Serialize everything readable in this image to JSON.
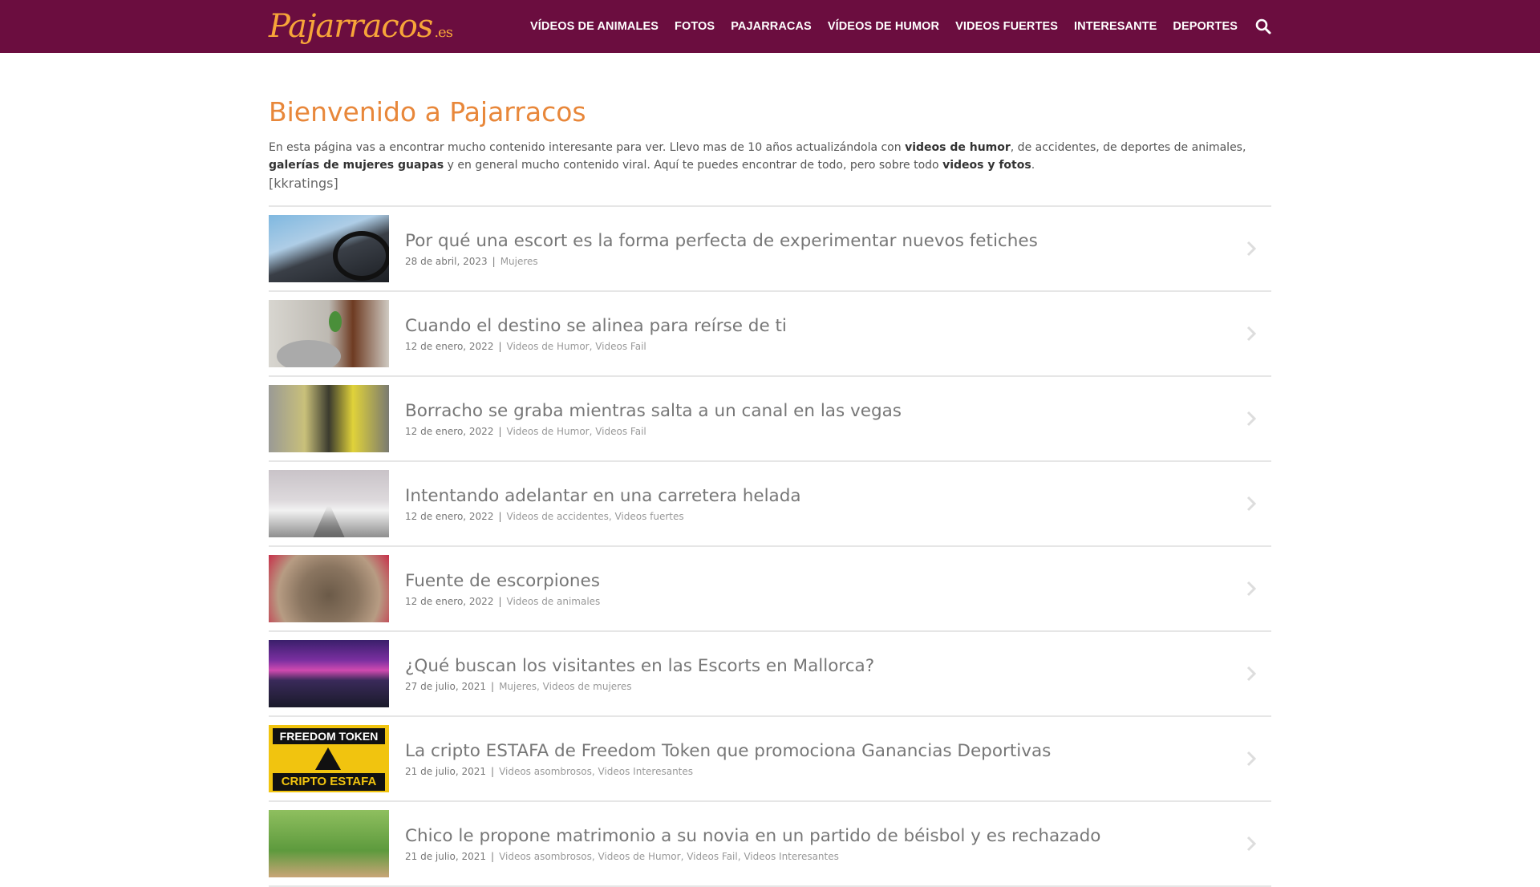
{
  "header": {
    "logo_text": "Pajarracos",
    "logo_suffix": ".es",
    "nav": [
      "VÍDEOS DE ANIMALES",
      "FOTOS",
      "PAJARRACAS",
      "VÍDEOS DE HUMOR",
      "VIDEOS FUERTES",
      "INTERESANTE",
      "DEPORTES"
    ],
    "search_icon": "search-icon"
  },
  "main": {
    "title": "Bienvenido a Pajarracos",
    "intro": {
      "t1": "En esta página vas a encontrar mucho contenido interesante para ver. Llevo mas de 10 años actualizándola con ",
      "b1": "videos de humor",
      "t2": ", de accidentes, de deportes de animales, ",
      "b2": "galerías de mujeres guapas",
      "t3": " y en general mucho contenido viral. Aquí te puedes encontrar de todo, pero sobre todo ",
      "b3": "videos y fotos",
      "t4": "."
    },
    "ratings": "[kkratings]"
  },
  "posts": [
    {
      "title": "Por qué una escort es la forma perfecta de experimentar nuevos fetiches",
      "date": "28 de abril, 2023",
      "cats": "Mujeres"
    },
    {
      "title": "Cuando el destino se alinea para reírse de ti",
      "date": "12 de enero, 2022",
      "cats": "Videos de Humor,  Videos Fail"
    },
    {
      "title": "Borracho se graba mientras salta a un canal en las vegas",
      "date": "12 de enero, 2022",
      "cats": "Videos de Humor,  Videos Fail"
    },
    {
      "title": "Intentando adelantar en una carretera helada",
      "date": "12 de enero, 2022",
      "cats": "Videos de accidentes,  Videos fuertes"
    },
    {
      "title": "Fuente de escorpiones",
      "date": "12 de enero, 2022",
      "cats": "Videos de animales"
    },
    {
      "title": "¿Qué buscan los visitantes en las Escorts en Mallorca?",
      "date": "27 de julio, 2021",
      "cats": "Mujeres,  Videos de mujeres"
    },
    {
      "title": "La cripto ESTAFA de Freedom Token que promociona Ganancias Deportivas",
      "date": "21 de julio, 2021",
      "cats": "Videos asombrosos,  Videos Interesantes",
      "thumb_top": "FREEDOM TOKEN",
      "thumb_bottom": "CRIPTO ESTAFA"
    },
    {
      "title": "Chico le propone matrimonio a su novia en un partido de béisbol y es rechazado",
      "date": "21 de julio, 2021",
      "cats": "Videos asombrosos,  Videos de Humor,  Videos Fail,  Videos Interesantes"
    }
  ],
  "colors": {
    "header_bg": "#6b0d3f",
    "logo": "#f7a539",
    "title": "#e8873a"
  }
}
